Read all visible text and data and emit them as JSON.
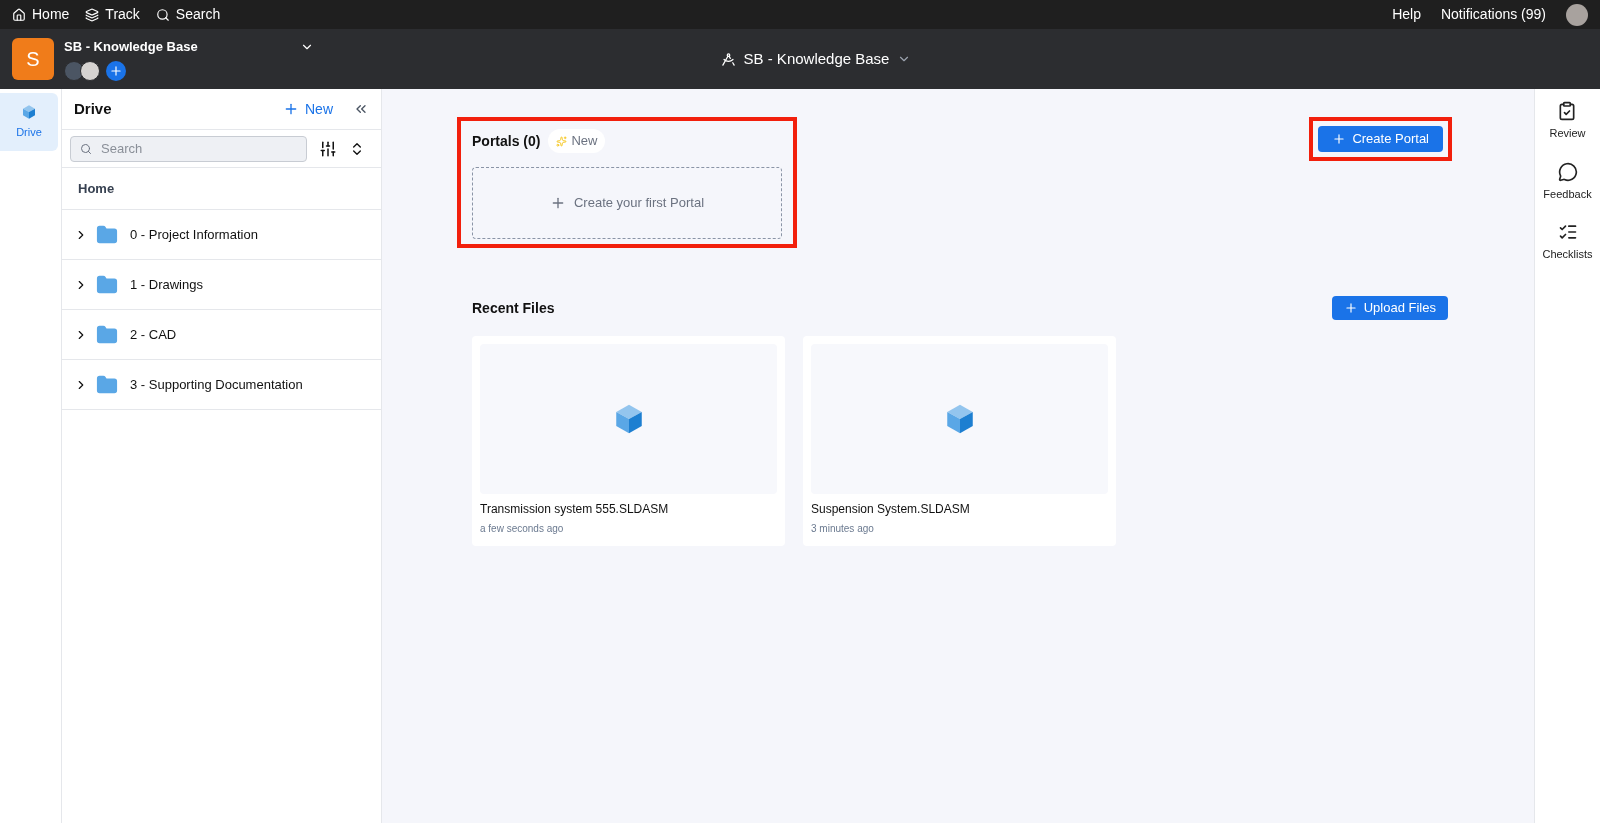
{
  "top_nav": {
    "left": [
      {
        "kind": "home",
        "label": "Home"
      },
      {
        "kind": "track",
        "label": "Track"
      },
      {
        "kind": "search",
        "label": "Search"
      }
    ],
    "right": [
      {
        "label": "Help"
      },
      {
        "label": "Notifications (99)"
      }
    ]
  },
  "project": {
    "initial": "S",
    "name": "SB - Knowledge Base",
    "center_title": "SB - Knowledge Base"
  },
  "left_rail": [
    {
      "label": "Drive",
      "selected": true
    }
  ],
  "drive": {
    "title": "Drive",
    "new_label": "New",
    "search": {
      "placeholder": "Search"
    },
    "home_label": "Home",
    "tree": [
      {
        "label": "0 - Project Information",
        "expanded": false
      },
      {
        "label": "1 - Drawings",
        "expanded": false
      },
      {
        "label": "2 - CAD",
        "expanded": false
      },
      {
        "label": "3 - Supporting Documentation",
        "expanded": false
      }
    ]
  },
  "portals": {
    "title": "Portals (0)",
    "badge": "New",
    "empty_label": "Create your first Portal",
    "create_button": "Create Portal",
    "highlighted": true
  },
  "recent": {
    "title": "Recent Files",
    "upload_button": "Upload Files",
    "files": [
      {
        "name": "Transmission system 555.SLDASM",
        "time": "a few seconds ago"
      },
      {
        "name": "Suspension System.SLDASM",
        "time": "3 minutes ago"
      }
    ]
  },
  "right_rail": [
    {
      "kind": "review",
      "label": "Review"
    },
    {
      "kind": "feedback",
      "label": "Feedback"
    },
    {
      "kind": "checklists",
      "label": "Checklists"
    }
  ]
}
